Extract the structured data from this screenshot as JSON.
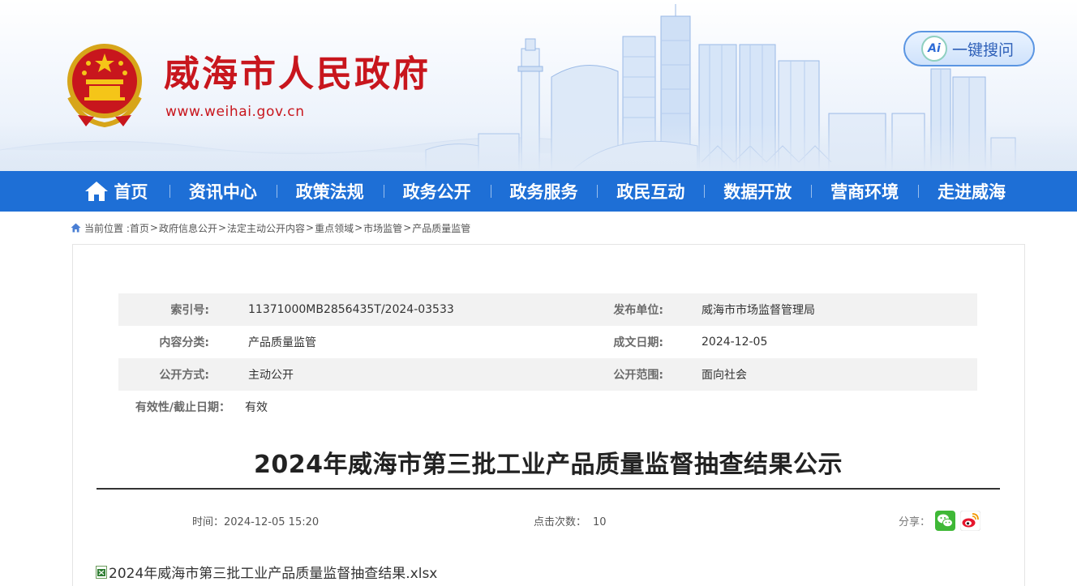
{
  "header": {
    "site_title": "威海市人民政府",
    "site_url": "www.weihai.gov.cn",
    "ai_search": {
      "badge": "Ai",
      "label": "一键搜问"
    },
    "colors": {
      "brand_red": "#c8161d",
      "nav_blue": "#1e6fd6"
    }
  },
  "nav": {
    "items": [
      {
        "label": "首页",
        "icon": "home-icon"
      },
      {
        "label": "资讯中心"
      },
      {
        "label": "政策法规"
      },
      {
        "label": "政务公开"
      },
      {
        "label": "政务服务"
      },
      {
        "label": "政民互动"
      },
      {
        "label": "数据开放"
      },
      {
        "label": "营商环境"
      },
      {
        "label": "走进威海"
      }
    ]
  },
  "breadcrumb": {
    "prefix": "当前位置 :",
    "items": [
      "首页",
      "政府信息公开",
      "法定主动公开内容",
      "重点领域",
      "市场监管",
      "产品质量监管"
    ],
    "separator": ">"
  },
  "meta": {
    "index_label": "索引号:",
    "index_value": "11371000MB2856435T/2024-03533",
    "publisher_label": "发布单位:",
    "publisher_value": "威海市市场监督管理局",
    "category_label": "内容分类:",
    "category_value": "产品质量监管",
    "date_label": "成文日期:",
    "date_value": "2024-12-05",
    "method_label": "公开方式:",
    "method_value": "主动公开",
    "scope_label": "公开范围:",
    "scope_value": "面向社会",
    "validity_label": "有效性/截止日期：",
    "validity_value": "有效"
  },
  "article": {
    "title": "2024年威海市第三批工业产品质量监督抽查结果公示",
    "time": "时间：2024-12-05 15:20",
    "hits_label": "点击次数：",
    "hits_value": "10",
    "share_label": "分享：",
    "share_icons": [
      "wechat-icon",
      "weibo-icon"
    ],
    "attachment": {
      "icon": "xls-file-icon",
      "name": "2024年威海市第三批工业产品质量监督抽查结果.xlsx"
    }
  }
}
